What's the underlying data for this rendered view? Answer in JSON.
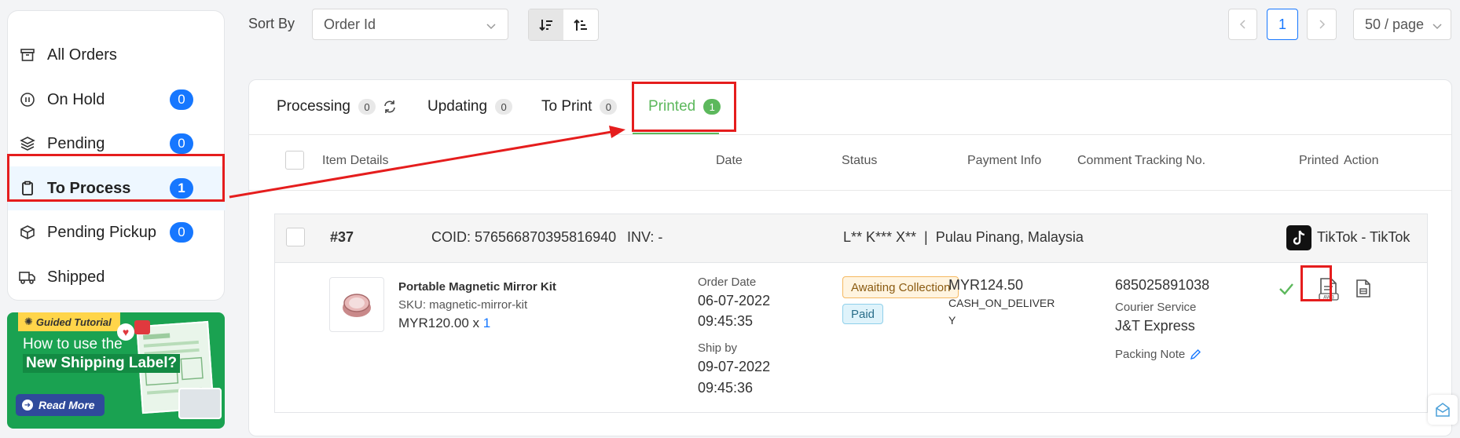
{
  "sidebar": {
    "items": [
      {
        "label": "All Orders",
        "icon": "archive-icon"
      },
      {
        "label": "On Hold",
        "icon": "pause-circle-icon",
        "badge": "0"
      },
      {
        "label": "Pending",
        "icon": "layers-icon",
        "badge": "0"
      },
      {
        "label": "To Process",
        "icon": "clipboard-icon",
        "badge": "1"
      },
      {
        "label": "Pending Pickup",
        "icon": "box-icon",
        "badge": "0"
      },
      {
        "label": "Shipped",
        "icon": "truck-icon"
      }
    ]
  },
  "banner": {
    "tag": "Guided Tutorial",
    "line1": "How to use the",
    "line2": "New Shipping Label?",
    "button": "Read More"
  },
  "toolbar": {
    "sort_label": "Sort By",
    "sort_value": "Order Id",
    "page_current": "1",
    "page_size": "50 / page"
  },
  "tabs": [
    {
      "label": "Processing",
      "count": "0"
    },
    {
      "label": "Updating",
      "count": "0"
    },
    {
      "label": "To Print",
      "count": "0"
    },
    {
      "label": "Printed",
      "count": "1"
    }
  ],
  "columns": [
    "Item Details",
    "Date",
    "Status",
    "Payment Info",
    "Comment",
    "Tracking No.",
    "Printed",
    "Action"
  ],
  "order": {
    "number": "#37",
    "coid": "COID: 576566870395816940",
    "inv": "INV: -",
    "customer": "L** K*** X**  |  Pulau Pinang, Malaysia",
    "channel": "TikTok - TikTok",
    "product_name": "Portable Magnetic Mirror Kit",
    "sku": "SKU: magnetic-mirror-kit",
    "price": "MYR120.00 x",
    "qty": "1",
    "order_date_label": "Order Date",
    "order_date": "06-07-2022",
    "order_time": "09:45:35",
    "ship_by_label": "Ship by",
    "ship_date": "09-07-2022",
    "ship_time": "09:45:36",
    "status1": "Awaiting Collection",
    "status2": "Paid",
    "amount": "MYR124.50",
    "method_line1": "CASH_ON_DELIVER",
    "method_line2": "Y",
    "tracking": "685025891038",
    "courier_label": "Courier Service",
    "courier": "J&T Express",
    "packing_note": "Packing Note"
  },
  "colors": {
    "accent": "#1677ff",
    "success": "#5cb85c",
    "highlight": "#e51d1d"
  }
}
